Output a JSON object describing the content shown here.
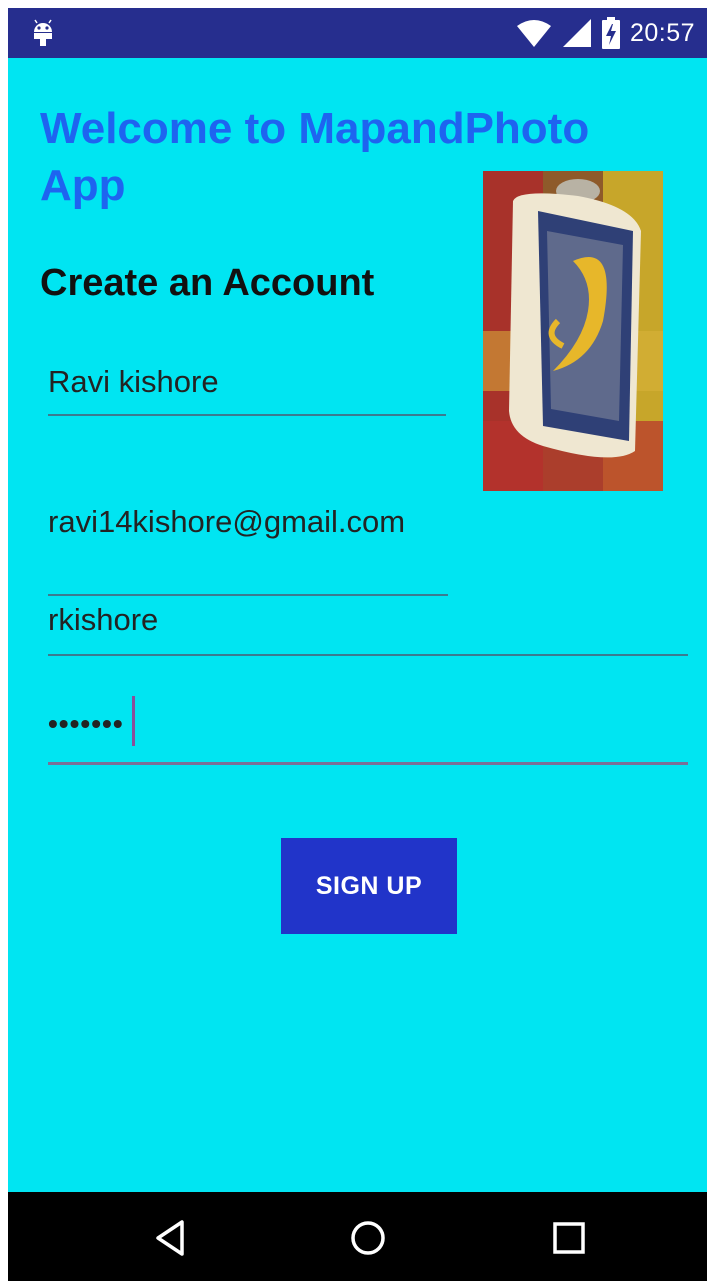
{
  "status_bar": {
    "time": "20:57",
    "icons": [
      "android-debug-icon",
      "wifi-icon",
      "cell-signal-icon",
      "battery-charging-icon"
    ]
  },
  "screen": {
    "title": "Welcome to MapandPhoto App",
    "heading": "Create an Account",
    "fields": {
      "name": "Ravi kishore",
      "email": "ravi14kishore@gmail.com",
      "username": "rkishore",
      "password": "•••••••"
    },
    "photo": "profile-photo-umkc-roos",
    "signup_label": "SIGN UP"
  },
  "nav_bar": {
    "icons": [
      "back-icon",
      "home-icon",
      "recents-icon"
    ]
  },
  "colors": {
    "status_bar": "#262e8e",
    "background": "#00e5f2",
    "title": "#1e64f0",
    "button": "#2134c9",
    "nav_bar": "#000000"
  }
}
